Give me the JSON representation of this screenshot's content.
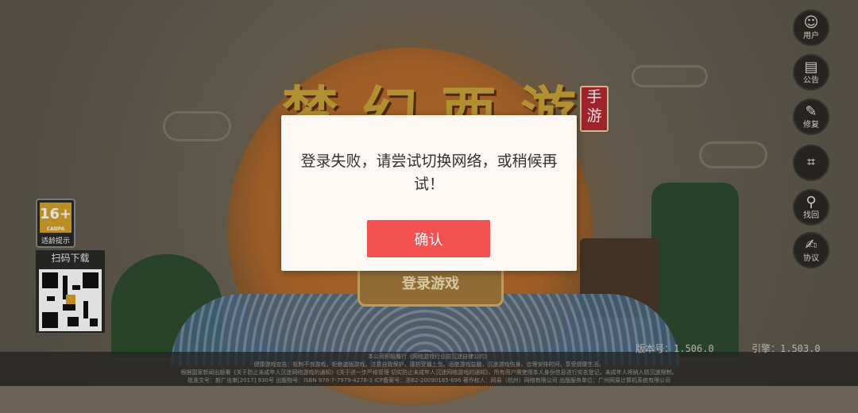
{
  "logo": {
    "title": "梦幻西游",
    "tag": "手游"
  },
  "login_button": "登录游戏",
  "sidebar": [
    {
      "icon": "user-icon",
      "label": "用户",
      "glyph": "☺"
    },
    {
      "icon": "notice-icon",
      "label": "公告",
      "glyph": "▤"
    },
    {
      "icon": "wrench-icon",
      "label": "修复",
      "glyph": "✎"
    },
    {
      "icon": "scan-icon",
      "label": "",
      "glyph": "⌗"
    },
    {
      "icon": "search-icon",
      "label": "找回",
      "glyph": "⚲"
    },
    {
      "icon": "agreement-icon",
      "label": "协议",
      "glyph": "✍"
    }
  ],
  "age_rating": {
    "value": "16+",
    "org": "CADPA",
    "caption": "适龄提示"
  },
  "qr": {
    "title": "扫码下载"
  },
  "footer_lines": [
    "本公司积极履行《网络游戏行业防沉迷自律公约》",
    "健康游戏忠告：抵制不良游戏，拒绝盗版游戏。注意自我保护，谨防受骗上当。适度游戏益脑，沉迷游戏伤身。合理安排时间，享受健康生活。",
    "根据国家新闻出版署《关于防止未成年人沉迷网络游戏的通知》《关于进一步严格管理 切实防止未成年人沉迷网络游戏的通知》，所有用户需使用本人身份信息进行实名登记，未成年人将纳入防沉迷限制。",
    "批准文号：新广出审[2017] 930号  出版物号：ISBN 978-7-7979-4278-3  ICP备案号：浙B2-20090185-696  著作权人：网易（杭州）网络有限公司  出版服务单位：广州网易计算机系统有限公司"
  ],
  "version": "版本号：1.506.0",
  "engine": "引擎：1.503.0",
  "dialog": {
    "message": "登录失败，请尝试切换网络，或稍候再试！",
    "confirm": "确认"
  }
}
